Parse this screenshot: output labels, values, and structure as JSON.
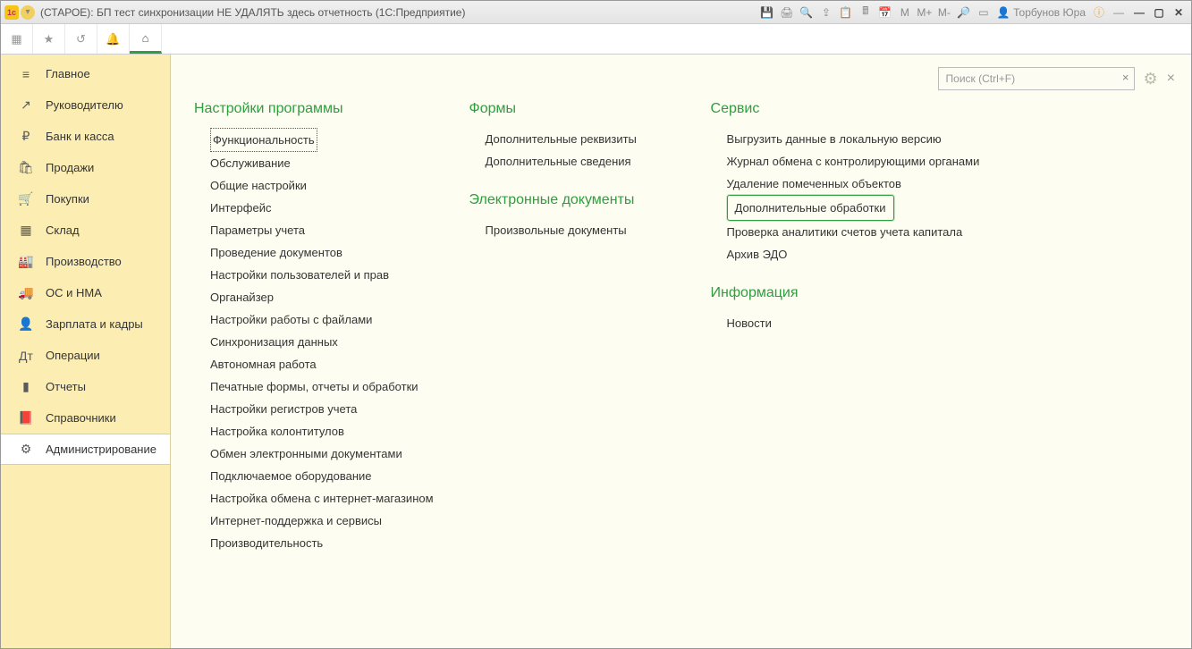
{
  "titlebar": {
    "title": "(СТАРОЕ): БП тест синхронизации НЕ УДАЛЯТЬ здесь отчетность  (1С:Предприятие)",
    "m_label": "M",
    "mplus_label": "M+",
    "mminus_label": "M-",
    "user_name": "Торбунов Юра"
  },
  "search": {
    "placeholder": "Поиск (Ctrl+F)"
  },
  "sidebar": {
    "items": [
      {
        "icon": "≡",
        "label": "Главное"
      },
      {
        "icon": "↗",
        "label": "Руководителю"
      },
      {
        "icon": "₽",
        "label": "Банк и касса"
      },
      {
        "icon": "🛍",
        "label": "Продажи"
      },
      {
        "icon": "🛒",
        "label": "Покупки"
      },
      {
        "icon": "▦",
        "label": "Склад"
      },
      {
        "icon": "🏭",
        "label": "Производство"
      },
      {
        "icon": "🚚",
        "label": "ОС и НМА"
      },
      {
        "icon": "👤",
        "label": "Зарплата и кадры"
      },
      {
        "icon": "Дт",
        "label": "Операции"
      },
      {
        "icon": "▮",
        "label": "Отчеты"
      },
      {
        "icon": "📕",
        "label": "Справочники"
      },
      {
        "icon": "⚙",
        "label": "Администрирование"
      }
    ],
    "active_index": 12
  },
  "columns": [
    {
      "groups": [
        {
          "title": "Настройки программы",
          "items": [
            "Функциональность",
            "Обслуживание",
            "Общие настройки",
            "Интерфейс",
            "Параметры учета",
            "Проведение документов",
            "Настройки пользователей и прав",
            "Органайзер",
            "Настройки работы с файлами",
            "Синхронизация данных",
            "Автономная работа",
            "Печатные формы, отчеты и обработки",
            "Настройки регистров учета",
            "Настройка колонтитулов",
            "Обмен электронными документами",
            "Подключаемое оборудование",
            "Настройка обмена с интернет-магазином",
            "Интернет-поддержка и сервисы",
            "Производительность"
          ],
          "dotted_index": 0
        }
      ]
    },
    {
      "groups": [
        {
          "title": "Формы",
          "items": [
            "Дополнительные реквизиты",
            "Дополнительные сведения"
          ]
        },
        {
          "title": "Электронные документы",
          "items": [
            "Произвольные документы"
          ]
        }
      ]
    },
    {
      "groups": [
        {
          "title": "Сервис",
          "items": [
            "Выгрузить данные в локальную версию",
            "Журнал обмена с контролирующими органами",
            "Удаление помеченных объектов",
            "Дополнительные обработки",
            "Проверка аналитики счетов учета капитала",
            "Архив ЭДО"
          ],
          "green_index": 3
        },
        {
          "title": "Информация",
          "items": [
            "Новости"
          ]
        }
      ]
    }
  ]
}
